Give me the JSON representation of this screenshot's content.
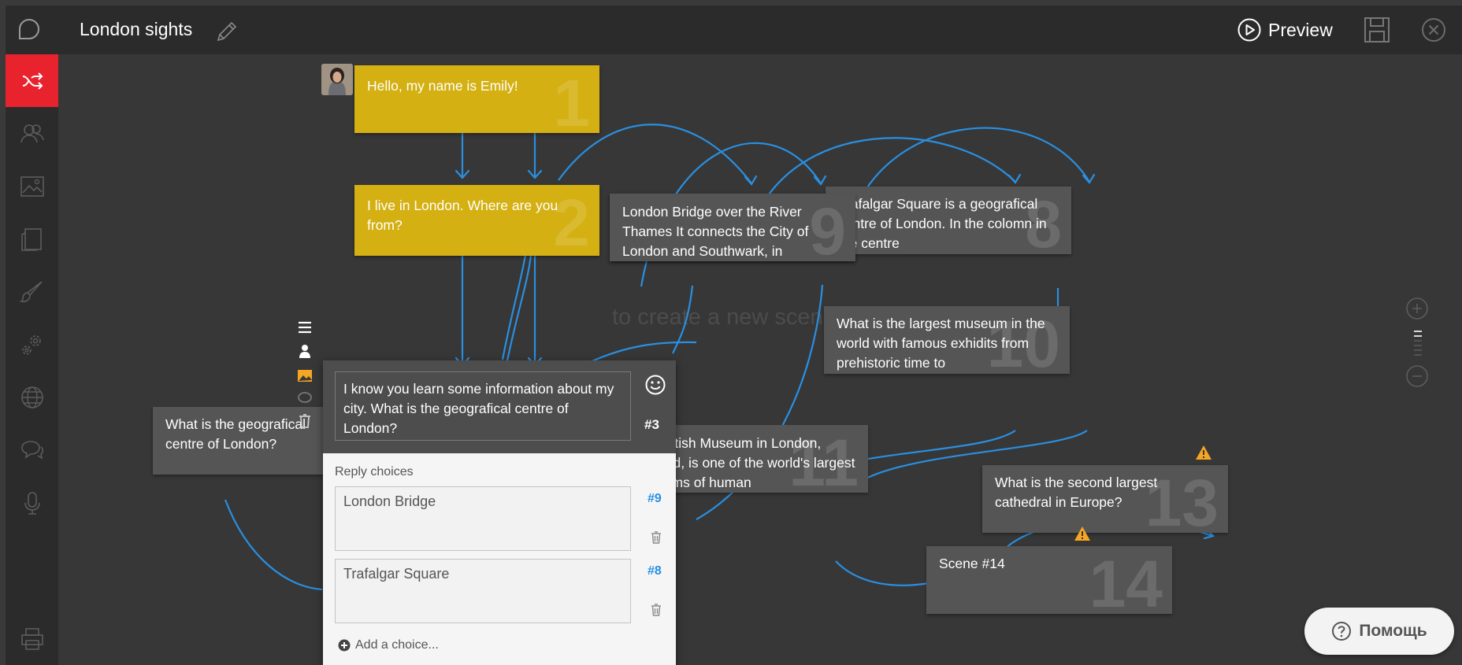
{
  "app": {
    "title": "London sights",
    "preview_label": "Preview",
    "canvas_hint": "to create a new scene",
    "help_label": "Помощь"
  },
  "colors": {
    "accent": "#e8232d",
    "yellow_scene": "#d4b012",
    "gray_scene": "#555555",
    "link": "#2a8fe0",
    "warning": "#f5a623"
  },
  "sidebar": {
    "items": [
      {
        "icon": "shuffle-icon",
        "active": true
      },
      {
        "icon": "characters-icon"
      },
      {
        "icon": "image-icon"
      },
      {
        "icon": "cards-icon"
      },
      {
        "icon": "brush-icon"
      },
      {
        "icon": "gears-icon"
      },
      {
        "icon": "globe-icon"
      },
      {
        "icon": "chat-bubbles-icon"
      },
      {
        "icon": "microphone-icon"
      },
      {
        "icon": "print-icon"
      }
    ]
  },
  "scenes": {
    "s1": {
      "text": "Hello, my name is Emily!",
      "num": "1"
    },
    "s2": {
      "text": "I live in London. Where are you from?",
      "num": "2"
    },
    "s9": {
      "text": "London Bridge over the River Thames It connects the City of London and Southwark, in",
      "num": "9"
    },
    "s8": {
      "text": "Trafalgar Square is a geografical centre of London. In the colomn in the centre",
      "num": "8"
    },
    "s10": {
      "text": "What is the largest museum in the world with famous exhidits from prehistoric time to",
      "num": "10"
    },
    "s_left": {
      "text": "What is the geografical centre of London?"
    },
    "s11": {
      "text": "The British Museum in London, England, is one of the world's largest museums of human",
      "num": "11"
    },
    "s13": {
      "text": "What is the second largest cathedral in Europe?",
      "num": "13"
    },
    "s14": {
      "text": "Scene #14",
      "num": "14"
    }
  },
  "editor": {
    "scene_text": "I know you learn some information about my city. What is the geografical centre of London?",
    "scene_num": "#3",
    "reply_label": "Reply choices",
    "choices": [
      {
        "text": "London Bridge",
        "ref": "#9"
      },
      {
        "text": "Trafalgar Square",
        "ref": "#8"
      }
    ],
    "add_choice_label": "Add a choice..."
  }
}
